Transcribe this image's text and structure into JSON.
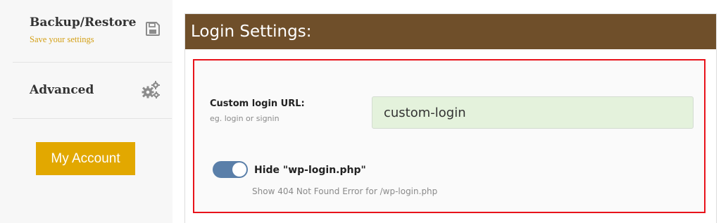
{
  "sidebar": {
    "items": [
      {
        "title": "Backup/Restore",
        "subtitle": "Save your settings",
        "icon": "save-icon"
      },
      {
        "title": "Advanced",
        "icon": "gears-icon"
      }
    ],
    "account_button": "My Account"
  },
  "panel": {
    "title": "Login Settings:",
    "custom_url": {
      "label": "Custom login URL:",
      "hint": "eg. login or signin",
      "value": "custom-login"
    },
    "hide_login": {
      "label": "Hide \"wp-login.php\"",
      "description": "Show 404 Not Found Error for /wp-login.php",
      "enabled": true
    }
  },
  "colors": {
    "header_bg": "#6f4f2a",
    "accent": "#e2a800",
    "highlight_border": "#e8131b",
    "toggle_on": "#5a7fa9",
    "input_bg": "#e4f2dc"
  }
}
